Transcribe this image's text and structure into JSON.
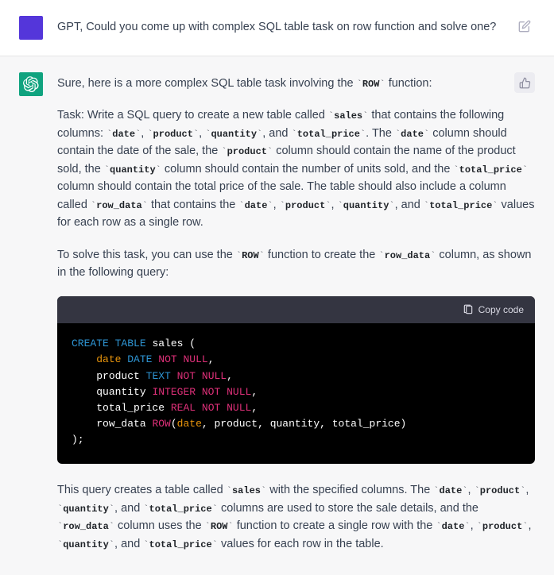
{
  "user_message": {
    "text": "GPT, Could you come up with complex SQL table task on row function and solve one?"
  },
  "assistant_message": {
    "para1_parts": [
      {
        "t": "text",
        "v": "Sure, here is a more complex SQL table task involving the "
      },
      {
        "t": "code",
        "v": "ROW"
      },
      {
        "t": "text",
        "v": " function:"
      }
    ],
    "para2_parts": [
      {
        "t": "text",
        "v": "Task: Write a SQL query to create a new table called "
      },
      {
        "t": "code",
        "v": "sales"
      },
      {
        "t": "text",
        "v": " that contains the following columns: "
      },
      {
        "t": "code",
        "v": "date"
      },
      {
        "t": "text",
        "v": ", "
      },
      {
        "t": "code",
        "v": "product"
      },
      {
        "t": "text",
        "v": ", "
      },
      {
        "t": "code",
        "v": "quantity"
      },
      {
        "t": "text",
        "v": ", and "
      },
      {
        "t": "code",
        "v": "total_price"
      },
      {
        "t": "text",
        "v": ". The "
      },
      {
        "t": "code",
        "v": "date"
      },
      {
        "t": "text",
        "v": " column should contain the date of the sale, the "
      },
      {
        "t": "code",
        "v": "product"
      },
      {
        "t": "text",
        "v": " column should contain the name of the product sold, the "
      },
      {
        "t": "code",
        "v": "quantity"
      },
      {
        "t": "text",
        "v": " column should contain the number of units sold, and the "
      },
      {
        "t": "code",
        "v": "total_price"
      },
      {
        "t": "text",
        "v": " column should contain the total price of the sale. The table should also include a column called "
      },
      {
        "t": "code",
        "v": "row_data"
      },
      {
        "t": "text",
        "v": " that contains the "
      },
      {
        "t": "code",
        "v": "date"
      },
      {
        "t": "text",
        "v": ", "
      },
      {
        "t": "code",
        "v": "product"
      },
      {
        "t": "text",
        "v": ", "
      },
      {
        "t": "code",
        "v": "quantity"
      },
      {
        "t": "text",
        "v": ", and "
      },
      {
        "t": "code",
        "v": "total_price"
      },
      {
        "t": "text",
        "v": " values for each row as a single row."
      }
    ],
    "para3_parts": [
      {
        "t": "text",
        "v": "To solve this task, you can use the "
      },
      {
        "t": "code",
        "v": "ROW"
      },
      {
        "t": "text",
        "v": " function to create the "
      },
      {
        "t": "code",
        "v": "row_data"
      },
      {
        "t": "text",
        "v": " column, as shown in the following query:"
      }
    ],
    "copy_label": "Copy code",
    "code_tokens": [
      [
        {
          "c": "tok-kw",
          "v": "CREATE"
        },
        {
          "c": "sp",
          "v": " "
        },
        {
          "c": "tok-kw",
          "v": "TABLE"
        },
        {
          "c": "sp",
          "v": " "
        },
        {
          "c": "tok-id",
          "v": "sales ("
        }
      ],
      [
        {
          "c": "indent",
          "v": "    "
        },
        {
          "c": "tok-col",
          "v": "date"
        },
        {
          "c": "sp",
          "v": " "
        },
        {
          "c": "tok-type",
          "v": "DATE"
        },
        {
          "c": "sp",
          "v": " "
        },
        {
          "c": "tok-nn",
          "v": "NOT"
        },
        {
          "c": "sp",
          "v": " "
        },
        {
          "c": "tok-nn",
          "v": "NULL"
        },
        {
          "c": "tok-punc",
          "v": ","
        }
      ],
      [
        {
          "c": "indent",
          "v": "    "
        },
        {
          "c": "tok-id",
          "v": "product"
        },
        {
          "c": "sp",
          "v": " "
        },
        {
          "c": "tok-type",
          "v": "TEXT"
        },
        {
          "c": "sp",
          "v": " "
        },
        {
          "c": "tok-nn",
          "v": "NOT"
        },
        {
          "c": "sp",
          "v": " "
        },
        {
          "c": "tok-nn",
          "v": "NULL"
        },
        {
          "c": "tok-punc",
          "v": ","
        }
      ],
      [
        {
          "c": "indent",
          "v": "    "
        },
        {
          "c": "tok-id",
          "v": "quantity"
        },
        {
          "c": "sp",
          "v": " "
        },
        {
          "c": "tok-nn",
          "v": "INTEGER"
        },
        {
          "c": "sp",
          "v": " "
        },
        {
          "c": "tok-nn",
          "v": "NOT"
        },
        {
          "c": "sp",
          "v": " "
        },
        {
          "c": "tok-nn",
          "v": "NULL"
        },
        {
          "c": "tok-punc",
          "v": ","
        }
      ],
      [
        {
          "c": "indent",
          "v": "    "
        },
        {
          "c": "tok-id",
          "v": "total_price"
        },
        {
          "c": "sp",
          "v": " "
        },
        {
          "c": "tok-nn",
          "v": "REAL"
        },
        {
          "c": "sp",
          "v": " "
        },
        {
          "c": "tok-nn",
          "v": "NOT"
        },
        {
          "c": "sp",
          "v": " "
        },
        {
          "c": "tok-nn",
          "v": "NULL"
        },
        {
          "c": "tok-punc",
          "v": ","
        }
      ],
      [
        {
          "c": "indent",
          "v": "    "
        },
        {
          "c": "tok-id",
          "v": "row_data"
        },
        {
          "c": "sp",
          "v": " "
        },
        {
          "c": "tok-nn",
          "v": "ROW"
        },
        {
          "c": "tok-punc",
          "v": "("
        },
        {
          "c": "tok-col",
          "v": "date"
        },
        {
          "c": "tok-id",
          "v": ", product, quantity, total_price"
        },
        {
          "c": "tok-punc",
          "v": ")"
        }
      ],
      [
        {
          "c": "tok-punc",
          "v": ");"
        }
      ]
    ],
    "para4_parts": [
      {
        "t": "text",
        "v": "This query creates a table called "
      },
      {
        "t": "code",
        "v": "sales"
      },
      {
        "t": "text",
        "v": " with the specified columns. The "
      },
      {
        "t": "code",
        "v": "date"
      },
      {
        "t": "text",
        "v": ", "
      },
      {
        "t": "code",
        "v": "product"
      },
      {
        "t": "text",
        "v": ", "
      },
      {
        "t": "code",
        "v": "quantity"
      },
      {
        "t": "text",
        "v": ", and "
      },
      {
        "t": "code",
        "v": "total_price"
      },
      {
        "t": "text",
        "v": " columns are used to store the sale details, and the "
      },
      {
        "t": "code",
        "v": "row_data"
      },
      {
        "t": "text",
        "v": " column uses the "
      },
      {
        "t": "code",
        "v": "ROW"
      },
      {
        "t": "text",
        "v": " function to create a single row with the "
      },
      {
        "t": "code",
        "v": "date"
      },
      {
        "t": "text",
        "v": ", "
      },
      {
        "t": "code",
        "v": "product"
      },
      {
        "t": "text",
        "v": ", "
      },
      {
        "t": "code",
        "v": "quantity"
      },
      {
        "t": "text",
        "v": ", and "
      },
      {
        "t": "code",
        "v": "total_price"
      },
      {
        "t": "text",
        "v": " values for each row in the table."
      }
    ]
  }
}
